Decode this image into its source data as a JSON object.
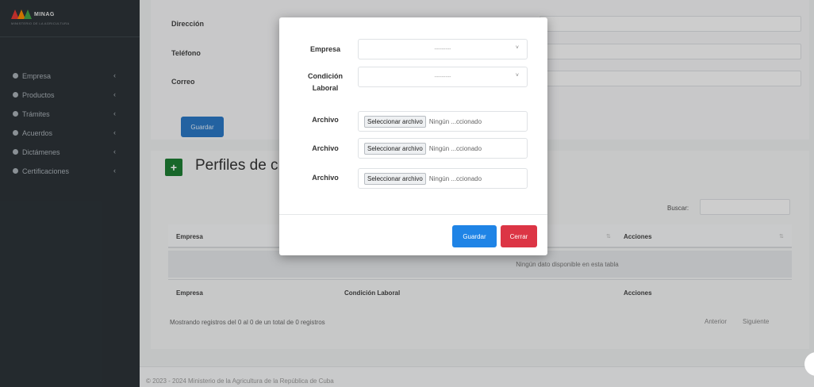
{
  "app": {
    "logo_text": "MINAG",
    "logo_subtext": "MINISTERIO DE LA AGRICULTURA",
    "brand_colors": [
      "#e53935",
      "#fb8c00",
      "#43a047"
    ]
  },
  "sidebar": {
    "items": [
      {
        "label": "Empresa",
        "icon": "circle-icon",
        "chevron": "‹"
      },
      {
        "label": "Productos",
        "icon": "circle-icon",
        "chevron": "‹"
      },
      {
        "label": "Trámites",
        "icon": "circle-icon",
        "chevron": "‹"
      },
      {
        "label": "Acuerdos",
        "icon": "circle-icon",
        "chevron": "‹"
      },
      {
        "label": "Dictámenes",
        "icon": "circle-icon",
        "chevron": "‹"
      },
      {
        "label": "Certificaciones",
        "icon": "circle-icon",
        "chevron": "‹"
      }
    ]
  },
  "form": {
    "fields": [
      {
        "label": "Dirección"
      },
      {
        "label": "Teléfono"
      },
      {
        "label": "Correo"
      }
    ],
    "save_label": "Guardar"
  },
  "section": {
    "add_icon": "+",
    "title": "Perfiles de c",
    "search_label": "Buscar:",
    "columns": [
      "Empresa",
      "Condición Laboral",
      "Acciones"
    ],
    "empty_text": "Ningún dato disponible en esta tabla",
    "info": "Mostrando registros del 0 al 0 de un total de 0 registros",
    "prev": "Anterior",
    "next": "Siguiente"
  },
  "footer": {
    "text": "© 2023 - 2024 Ministerio de la Agricultura de la República de Cuba"
  },
  "modal": {
    "empresa_label": "Empresa",
    "empresa_value": "---------",
    "condicion_label_1": "Condición",
    "condicion_label_2": "Laboral",
    "condicion_value": "---------",
    "files": [
      {
        "label": "Archivo",
        "button": "Seleccionar archivo",
        "status": "Ningún ...ccionado"
      },
      {
        "label": "Archivo",
        "button": "Seleccionar archivo",
        "status": "Ningún ...ccionado"
      },
      {
        "label": "Archivo",
        "button": "Seleccionar archivo",
        "status": "Ningún ...ccionado"
      }
    ],
    "guardar_label": "Guardar",
    "cerrar_label": "Cerrar",
    "caret": "˅"
  }
}
